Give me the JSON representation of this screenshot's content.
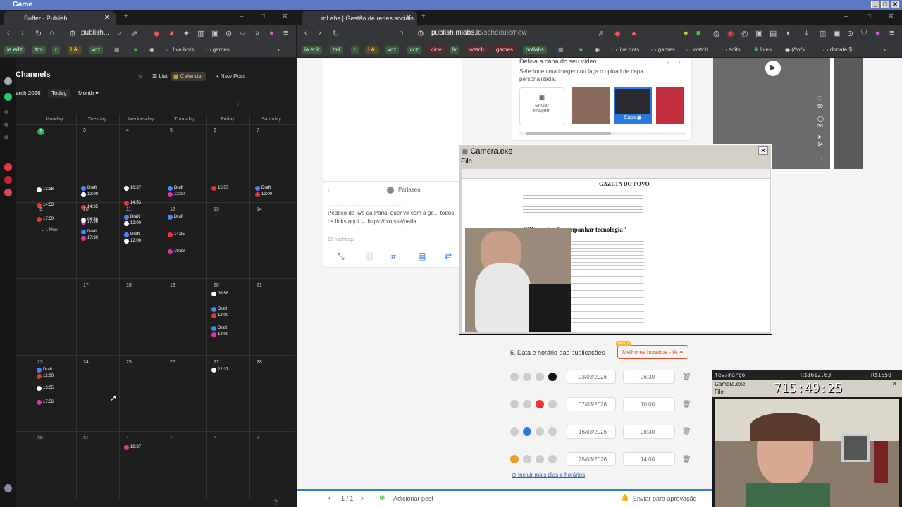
{
  "os": {
    "title": "Game"
  },
  "left_browser": {
    "tab_title": "Buffer - Publish",
    "tab_close": "✕",
    "url": "publish...",
    "bookmarks": [
      "ia edit",
      "tml",
      "r",
      "I.A.",
      "voz",
      "live bots",
      "games"
    ],
    "bookmark_overflow": "»"
  },
  "buffer": {
    "channels_title": "Channels",
    "view_list": "List",
    "view_calendar": "Calendar",
    "new_post": "+ New Post",
    "month_label": "arch 2026",
    "today": "Today",
    "month_select": "Month",
    "days": [
      "Monday",
      "Tuesday",
      "Wednesday",
      "Thursday",
      "Friday",
      "Saturday"
    ],
    "more": "1 More",
    "weeks": [
      [
        "2",
        "3",
        "4",
        "5",
        "6",
        "7"
      ],
      [
        "9",
        "10",
        "11",
        "12",
        "13",
        "14"
      ],
      [
        "16",
        "17",
        "18",
        "19",
        "20",
        "21"
      ],
      [
        "23",
        "24",
        "25",
        "26",
        "27",
        "28"
      ],
      [
        "30",
        "31",
        "1",
        "2",
        "3",
        "4"
      ]
    ],
    "posts": {
      "p1": "13:38",
      "p2": "14:53",
      "p3": "17:50",
      "p4": "Draft",
      "p4b": "12:00",
      "p5": "14:35",
      "p6": "17:56",
      "p7": "10:37",
      "p8": "14:53",
      "p9": "Draft",
      "p9b": "12:00",
      "p10": "15:57",
      "p11": "Draft",
      "p11b": "12:00",
      "p12": "06:56",
      "p13": "Draft",
      "p13b": "17:39",
      "p14": "Draft",
      "p14b": "12:00",
      "p15": "Draft",
      "p15b": "12:00",
      "p16": "Draft",
      "p16b": "14:35",
      "p17": "19:38",
      "p18": "06:58",
      "p19": "Draft",
      "p19b": "12:00",
      "p20": "Draft",
      "p20b": "12:00",
      "p21": "Draft",
      "p21b": "12:00",
      "p22": "13:05",
      "p23": "17:56",
      "p24": "22:37",
      "p25": "18:37"
    }
  },
  "right_browser": {
    "tab_title": "mLabs | Gestão de redes sociais",
    "url_host": "publish.mlabs.io",
    "url_path": "/schedule/new",
    "bookmarks": [
      "ia edit",
      "tml",
      "r",
      "I.A.",
      "voz",
      "ccz",
      "cine",
      "lv",
      "watch",
      "games",
      "botlabs",
      "live bots",
      "games",
      "watch",
      "edits",
      "lives",
      "(/ºoº)/",
      "donate $"
    ]
  },
  "mlabs": {
    "cover_title": "Defina a capa do seu vídeo",
    "cover_desc": "Selecione uma imagem ou faça o upload de capa personalizada:",
    "send_image": "Enviar imagem",
    "cover_badge": "Capa",
    "profile_name": "Parlasea",
    "caption": "Pedoço da live da Parla, quer vir com a ge... todos os links aqui → https://bio.site/parla",
    "hashtags": "12 hashtags",
    "section5": "5. Data e horário das publicações",
    "best_times": "Melhores horários - IA",
    "new_tag": "NOVO",
    "dates": [
      {
        "date": "03/03/2026",
        "time": "06:30"
      },
      {
        "date": "07/03/2026",
        "time": "10:00"
      },
      {
        "date": "16/03/2026",
        "time": "08:30"
      },
      {
        "date": "25/03/2026",
        "time": "14:00"
      }
    ],
    "add_more": "Incluir mais dias e horários",
    "pager": "1 / 1",
    "add_post": "Adicionar post",
    "send_approval": "Enviar para aprovação",
    "reel_likes": "50",
    "reel_comments": "50",
    "reel_shares": "14"
  },
  "camera": {
    "title": "Camera.exe",
    "menu": "File",
    "close": "✕",
    "doc_brand": "GAZETA DO POVO",
    "doc_heading": "CPI precisa \"acompanhar tecnologia\""
  },
  "smallcam": {
    "label": "fev/março",
    "value1": "R$1612.63",
    "value2": "R$1650",
    "title": "Camera.exe",
    "menu": "File",
    "timer": "715:49:25"
  },
  "colors": {
    "buffer_bg": "#1e1e1e",
    "mlabs_accent": "#e8502a",
    "link_blue": "#2a7ae2"
  }
}
